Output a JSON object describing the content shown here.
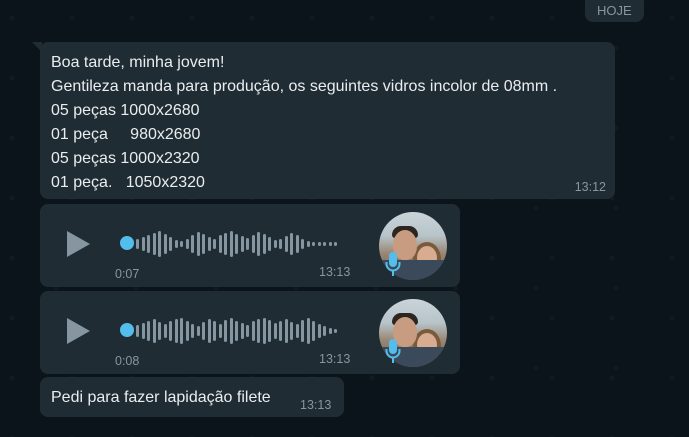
{
  "date_chip": "HOJE",
  "messages": {
    "text1": {
      "lines": [
        "Boa tarde, minha jovem!",
        "Gentileza manda para produção, os seguintes vidros incolor de 08mm .",
        "05 peças 1000x2680",
        "01 peça     980x2680",
        "05 peças 1000x2320",
        "01 peça.   1050x2320"
      ],
      "time": "13:12"
    },
    "voice1": {
      "duration": "0:07",
      "time": "13:13"
    },
    "voice2": {
      "duration": "0:08",
      "time": "13:13"
    },
    "text2": {
      "text": "Pedi para fazer lapidação filete",
      "time": "13:13"
    }
  },
  "colors": {
    "background": "#0b141a",
    "bubble": "#202c33",
    "text": "#e9edef",
    "meta": "#8696a0",
    "accent_blue": "#53bdeb"
  },
  "icons": {
    "play": "play-icon",
    "mic": "microphone-icon"
  }
}
